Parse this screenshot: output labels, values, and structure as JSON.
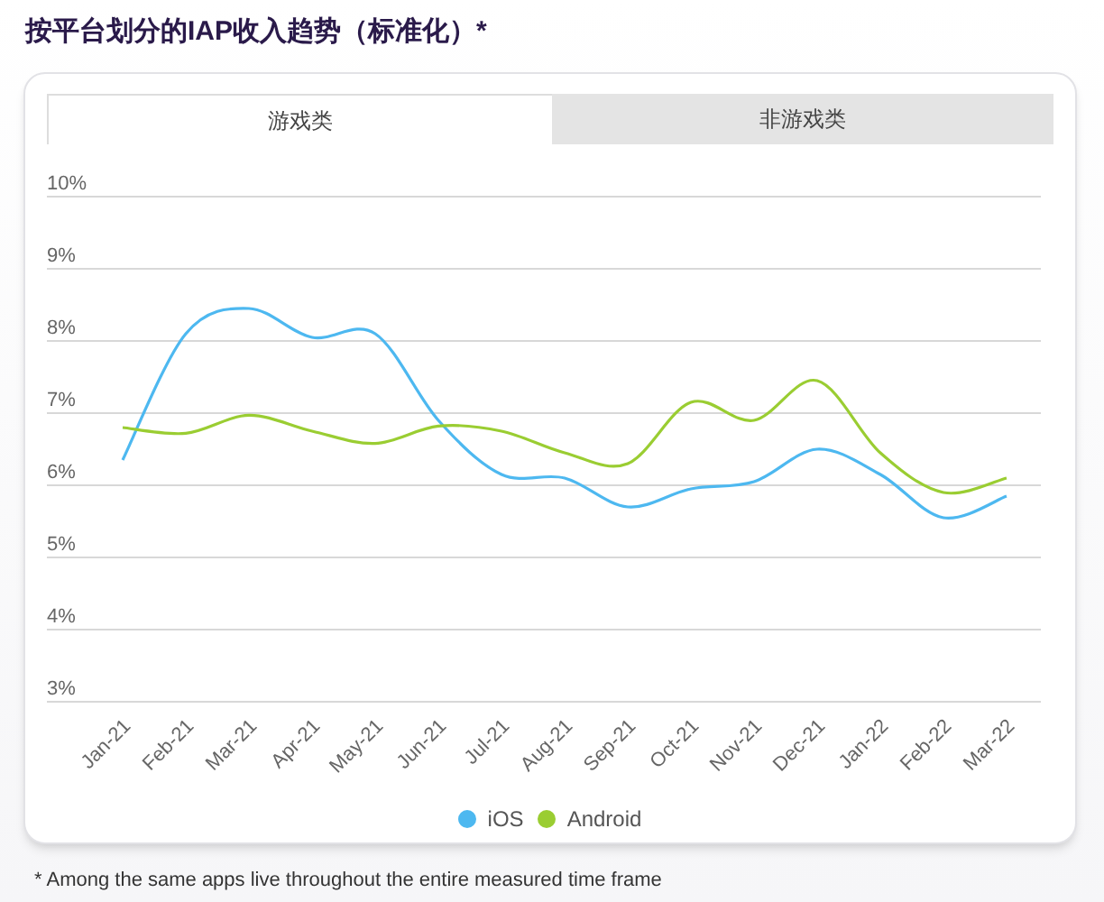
{
  "title": "按平台划分的IAP收入趋势（标准化）*",
  "tabs": [
    {
      "label": "游戏类",
      "selected": true
    },
    {
      "label": "非游戏类",
      "selected": false
    }
  ],
  "chart_data": {
    "type": "line",
    "categories": [
      "Jan-21",
      "Feb-21",
      "Mar-21",
      "Apr-21",
      "May-21",
      "Jun-21",
      "Jul-21",
      "Aug-21",
      "Sep-21",
      "Oct-21",
      "Nov-21",
      "Dec-21",
      "Jan-22",
      "Feb-22",
      "Mar-22"
    ],
    "ylim": [
      3,
      10
    ],
    "grid": true,
    "yticks": [
      {
        "value": 10,
        "label": "10%"
      },
      {
        "value": 9,
        "label": "9%"
      },
      {
        "value": 8,
        "label": "8%"
      },
      {
        "value": 7,
        "label": "7%"
      },
      {
        "value": 6,
        "label": "6%"
      },
      {
        "value": 5,
        "label": "5%"
      },
      {
        "value": 4,
        "label": "4%"
      },
      {
        "value": 3,
        "label": "3%"
      }
    ],
    "series": [
      {
        "name": "iOS",
        "color": "#4db8f0",
        "values": [
          6.35,
          8.1,
          8.45,
          8.05,
          8.1,
          6.9,
          6.15,
          6.1,
          5.7,
          5.95,
          6.05,
          6.5,
          6.15,
          5.55,
          5.85
        ]
      },
      {
        "name": "Android",
        "color": "#9acd32",
        "values": [
          6.8,
          6.72,
          6.97,
          6.75,
          6.58,
          6.82,
          6.75,
          6.45,
          6.3,
          7.15,
          6.9,
          7.45,
          6.45,
          5.9,
          6.1
        ]
      }
    ]
  },
  "footnote": "* Among the same apps live throughout the entire measured time frame"
}
